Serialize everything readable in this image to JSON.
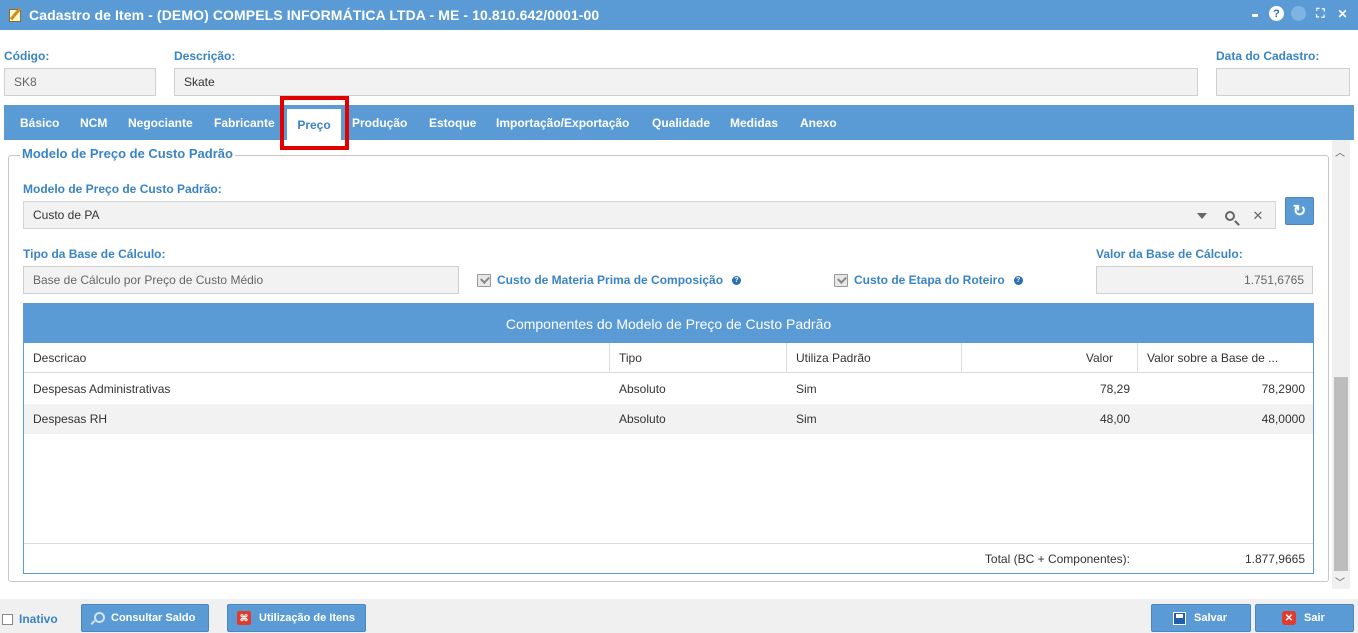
{
  "window": {
    "title": "Cadastro de Item - (DEMO) COMPELS INFORMÁTICA LTDA - ME - 10.810.642/0001-00",
    "buttons": {
      "minimize": "",
      "help": "?",
      "fullscreen": "⛶",
      "close": "✕"
    }
  },
  "header": {
    "codigo_label": "Código:",
    "codigo_value": "SK8",
    "descricao_label": "Descrição:",
    "descricao_value": "Skate",
    "data_cadastro_label": "Data do Cadastro:",
    "data_cadastro_value": ""
  },
  "tabs": [
    {
      "label": "Básico"
    },
    {
      "label": "NCM"
    },
    {
      "label": "Negociante"
    },
    {
      "label": "Fabricante"
    },
    {
      "label": "Preço",
      "active": true
    },
    {
      "label": "Produção"
    },
    {
      "label": "Estoque"
    },
    {
      "label": "Importação/Exportação"
    },
    {
      "label": "Qualidade"
    },
    {
      "label": "Medidas"
    },
    {
      "label": "Anexo"
    }
  ],
  "section": {
    "legend": "Modelo de Preço de Custo Padrão",
    "modelo_label": "Modelo de Preço de Custo Padrão:",
    "modelo_value": "Custo de PA",
    "tipo_base_label": "Tipo da Base de Cálculo:",
    "tipo_base_value": "Base de Cálculo por Preço de Custo Médio",
    "chk_materia_prima": "Custo de Materia Prima de Composição",
    "chk_etapa_roteiro": "Custo de Etapa do Roteiro",
    "valor_base_label": "Valor da Base de Cálculo:",
    "valor_base_value": "1.751,6765"
  },
  "grid": {
    "caption": "Componentes do Modelo de Preço de Custo Padrão",
    "columns": [
      "Descricao",
      "Tipo",
      "Utiliza Padrão",
      "Valor",
      "Valor sobre a Base de ..."
    ],
    "rows": [
      [
        "Despesas Administrativas",
        "Absoluto",
        "Sim",
        "78,29",
        "78,2900"
      ],
      [
        "Despesas RH",
        "Absoluto",
        "Sim",
        "48,00",
        "48,0000"
      ]
    ],
    "footer_label": "Total (BC + Componentes):",
    "footer_value": "1.877,9665"
  },
  "bottom": {
    "inativo": "Inativo",
    "consultar_saldo": "Consultar Saldo",
    "utilizacao_itens": "Utilização de Itens",
    "salvar": "Salvar",
    "sair": "Sair"
  },
  "colors": {
    "accent": "#5b9bd5",
    "label": "#3a84c5",
    "highlight": "#e00000"
  },
  "icons": [
    "edit-doc-icon",
    "help-icon",
    "fullscreen-icon",
    "close-icon",
    "chevron-down-icon",
    "search-icon",
    "clear-icon",
    "refresh-icon",
    "magnifier-icon",
    "pdf-icon",
    "save-icon",
    "exit-icon"
  ]
}
